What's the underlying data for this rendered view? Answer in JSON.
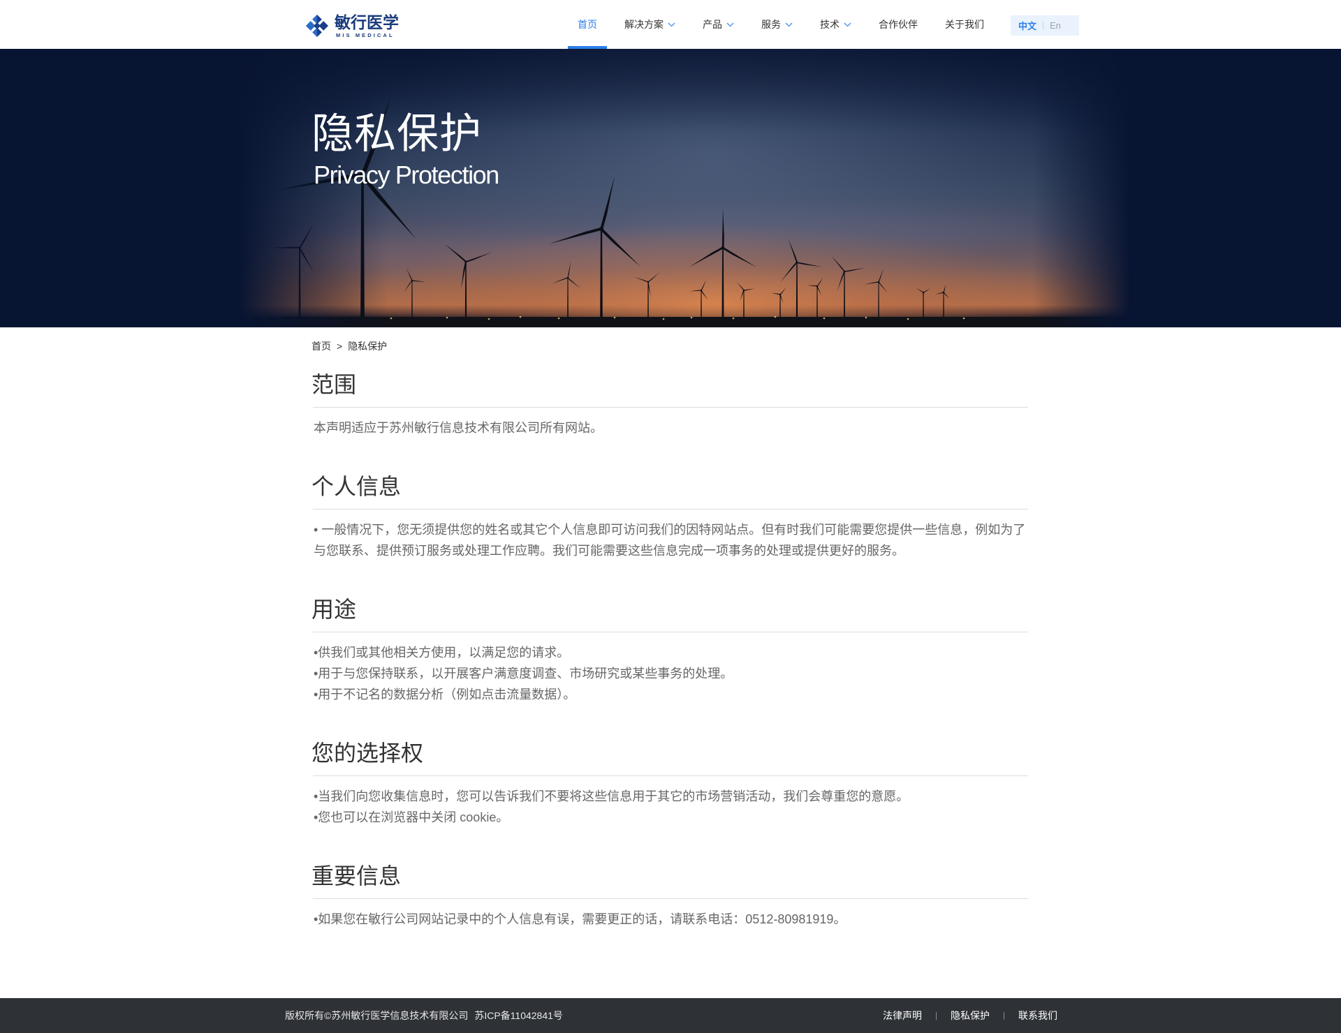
{
  "header": {
    "logo": {
      "name_cn": "敏行医学",
      "name_en": "MIS MEDICAL",
      "icon": "mis-medical-logo-icon"
    },
    "nav": [
      {
        "label": "首页",
        "active": true,
        "has_dropdown": false
      },
      {
        "label": "解决方案",
        "active": false,
        "has_dropdown": true
      },
      {
        "label": "产品",
        "active": false,
        "has_dropdown": true
      },
      {
        "label": "服务",
        "active": false,
        "has_dropdown": true
      },
      {
        "label": "技术",
        "active": false,
        "has_dropdown": true
      },
      {
        "label": "合作伙伴",
        "active": false,
        "has_dropdown": false
      },
      {
        "label": "关于我们",
        "active": false,
        "has_dropdown": false
      }
    ],
    "dropdown_icon": "chevron-down-icon",
    "language": {
      "active": "中文",
      "other": "En"
    }
  },
  "hero": {
    "title": "隐私保护",
    "subtitle": "Privacy Protection"
  },
  "breadcrumb": {
    "home": "首页",
    "separator": ">",
    "current": "隐私保护"
  },
  "sections": [
    {
      "heading": "范围",
      "lines": [
        "本声明适应于苏州敏行信息技术有限公司所有网站。"
      ]
    },
    {
      "heading": "个人信息",
      "lines": [
        "• 一般情况下，您无须提供您的姓名或其它个人信息即可访问我们的因特网站点。但有时我们可能需要您提供一些信息，例如为了与您联系、提供预订服务或处理工作应聘。我们可能需要这些信息完成一项事务的处理或提供更好的服务。"
      ]
    },
    {
      "heading": "用途",
      "lines": [
        "•供我们或其他相关方使用，以满足您的请求。",
        "•用于与您保持联系，以开展客户满意度调查、市场研究或某些事务的处理。",
        "•用于不记名的数据分析（例如点击流量数据）。"
      ]
    },
    {
      "heading": "您的选择权",
      "lines": [
        "•当我们向您收集信息时，您可以告诉我们不要将这些信息用于其它的市场营销活动，我们会尊重您的意愿。",
        "•您也可以在浏览器中关闭 cookie。"
      ]
    },
    {
      "heading": "重要信息",
      "lines": [
        "•如果您在敏行公司网站记录中的个人信息有误，需要更正的话，请联系电话：0512-80981919。"
      ]
    }
  ],
  "footer": {
    "copyright": "版权所有©苏州敏行医学信息技术有限公司",
    "icp": "苏ICP备11042841号",
    "links": [
      "法律声明",
      "隐私保护",
      "联系我们"
    ]
  },
  "colors": {
    "primary": "#2b7de9",
    "logo": "#1b3c7c",
    "body_text": "#666666",
    "heading": "#333333",
    "footer_bg": "#2e3136",
    "hero_bg": "#071432"
  }
}
